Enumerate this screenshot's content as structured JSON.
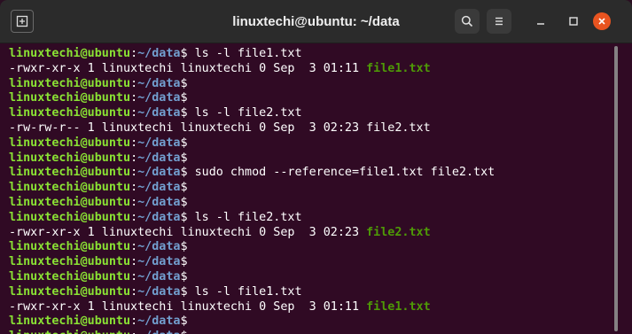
{
  "window": {
    "title": "linuxtechi@ubuntu: ~/data"
  },
  "icons": {
    "new_tab": "new-tab-icon",
    "search": "search-icon",
    "menu": "hamburger-menu-icon",
    "minimize": "minimize-icon",
    "maximize": "maximize-icon",
    "close": "close-icon"
  },
  "colors": {
    "terminal_bg": "#300a24",
    "prompt_user": "#8ae234",
    "prompt_path": "#729fcf",
    "exec_file": "#4e9a06",
    "close_button": "#e95420"
  },
  "prompt": {
    "user": "linuxtechi@ubuntu",
    "sep": ":",
    "path": "~/data",
    "symbol": "$"
  },
  "lines": [
    {
      "type": "prompt",
      "cmd": " ls -l file1.txt"
    },
    {
      "type": "out",
      "text": "-rwxr-xr-x 1 linuxtechi linuxtechi 0 Sep  3 01:11 ",
      "file": "file1.txt",
      "exec": true
    },
    {
      "type": "prompt",
      "cmd": ""
    },
    {
      "type": "prompt",
      "cmd": ""
    },
    {
      "type": "prompt",
      "cmd": " ls -l file2.txt"
    },
    {
      "type": "out",
      "text": "-rw-rw-r-- 1 linuxtechi linuxtechi 0 Sep  3 02:23 ",
      "file": "file2.txt",
      "exec": false
    },
    {
      "type": "prompt",
      "cmd": ""
    },
    {
      "type": "prompt",
      "cmd": ""
    },
    {
      "type": "prompt",
      "cmd": " sudo chmod --reference=file1.txt file2.txt"
    },
    {
      "type": "prompt",
      "cmd": ""
    },
    {
      "type": "prompt",
      "cmd": ""
    },
    {
      "type": "prompt",
      "cmd": " ls -l file2.txt"
    },
    {
      "type": "out",
      "text": "-rwxr-xr-x 1 linuxtechi linuxtechi 0 Sep  3 02:23 ",
      "file": "file2.txt",
      "exec": true
    },
    {
      "type": "prompt",
      "cmd": ""
    },
    {
      "type": "prompt",
      "cmd": ""
    },
    {
      "type": "prompt",
      "cmd": ""
    },
    {
      "type": "prompt",
      "cmd": " ls -l file1.txt"
    },
    {
      "type": "out",
      "text": "-rwxr-xr-x 1 linuxtechi linuxtechi 0 Sep  3 01:11 ",
      "file": "file1.txt",
      "exec": true
    },
    {
      "type": "prompt",
      "cmd": ""
    },
    {
      "type": "prompt",
      "cmd": " ",
      "cursor": true
    }
  ]
}
